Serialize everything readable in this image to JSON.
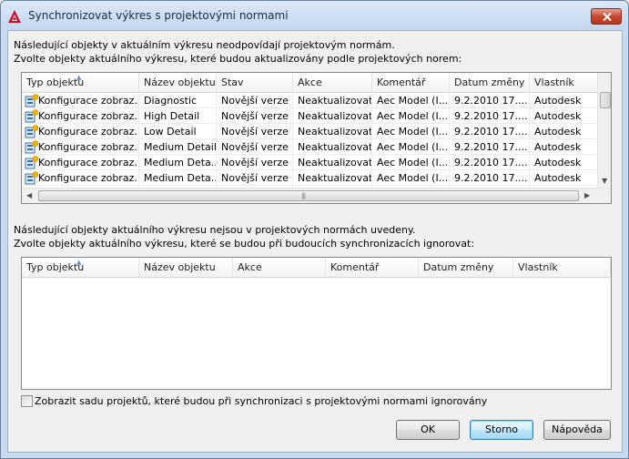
{
  "window": {
    "title": "Synchronizovat výkres s projektovými normami"
  },
  "top_section": {
    "description_line1": "Následující objekty v aktuálním výkresu neodpovídají projektovým normám.",
    "description_line2": "Zvolte objekty aktuálního výkresu, které budou aktualizovány podle projektových norem:",
    "columns": [
      "Typ objektu",
      "Název objektu",
      "Stav",
      "Akce",
      "Komentář",
      "Datum změny",
      "Vlastník"
    ],
    "rows": [
      [
        "Konfigurace zobraz...",
        "Diagnostic",
        "Novější verze",
        "Neaktualizovat",
        "Aec Model (I...",
        "9.2.2010 17....",
        "Autodesk"
      ],
      [
        "Konfigurace zobraz...",
        "High Detail",
        "Novější verze",
        "Neaktualizovat",
        "Aec Model (I...",
        "9.2.2010 17....",
        "Autodesk"
      ],
      [
        "Konfigurace zobraz...",
        "Low Detail",
        "Novější verze",
        "Neaktualizovat",
        "Aec Model (I...",
        "9.2.2010 17....",
        "Autodesk"
      ],
      [
        "Konfigurace zobraz...",
        "Medium Detail",
        "Novější verze",
        "Neaktualizovat",
        "Aec Model (I...",
        "9.2.2010 17....",
        "Autodesk"
      ],
      [
        "Konfigurace zobraz...",
        "Medium Deta...",
        "Novější verze",
        "Neaktualizovat",
        "Aec Model (I...",
        "9.2.2010 17....",
        "Autodesk"
      ],
      [
        "Konfigurace zobraz...",
        "Medium Deta...",
        "Novější verze",
        "Neaktualizovat",
        "Aec Model (I...",
        "9.2.2010 17....",
        "Autodesk"
      ]
    ]
  },
  "bottom_section": {
    "description_line1": "Následující objekty aktuálního výkresu nejsou v projektových normách uvedeny.",
    "description_line2": "Zvolte objekty aktuálního výkresu, které se budou při budoucích synchronizacích ignorovat:",
    "columns": [
      "Typ objektu",
      "Název objektu",
      "Akce",
      "Komentář",
      "Datum změny",
      "Vlastník"
    ]
  },
  "options": {
    "show_ignored_label": "Zobrazit sadu projektů, které budou při synchronizaci s projektovými normami ignorovány",
    "show_ignored_checked": false
  },
  "buttons": {
    "ok": "OK",
    "cancel": "Storno",
    "help": "Nápověda"
  },
  "colors": {
    "title_bar": "#c4d7ef",
    "close_button": "#c64a32",
    "default_button_border": "#3c7fb1",
    "app_icon": "#c8102e"
  },
  "icons": {
    "app": "autocad-logo-icon",
    "close": "close-icon",
    "row": "display-configuration-icon",
    "sort": "sort-ascending-icon"
  }
}
